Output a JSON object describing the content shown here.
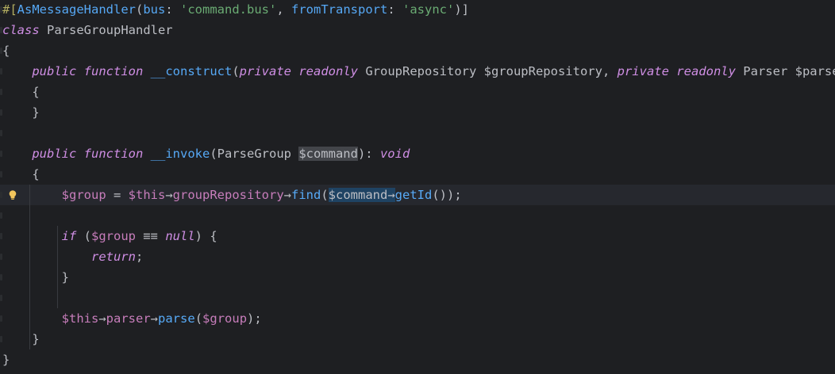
{
  "editor": {
    "language": "PHP",
    "background": "#1e1f22",
    "lines": [
      {
        "tokens": [
          {
            "t": "#[",
            "c": "t-attr"
          },
          {
            "t": "AsMessageHandler",
            "c": "t-fn"
          },
          {
            "t": "(",
            "c": "t-pl"
          },
          {
            "t": "bus",
            "c": "t-fn"
          },
          {
            "t": ": ",
            "c": "t-pl"
          },
          {
            "t": "'command.bus'",
            "c": "t-str"
          },
          {
            "t": ", ",
            "c": "t-pl"
          },
          {
            "t": "fromTransport",
            "c": "t-fn"
          },
          {
            "t": ": ",
            "c": "t-pl"
          },
          {
            "t": "'async'",
            "c": "t-str"
          },
          {
            "t": ")]",
            "c": "t-pl"
          }
        ]
      },
      {
        "tokens": [
          {
            "t": "class",
            "c": "t-kw"
          },
          {
            "t": " ParseGroupHandler",
            "c": "t-pl"
          }
        ]
      },
      {
        "tokens": [
          {
            "t": "{",
            "c": "t-pl"
          }
        ]
      },
      {
        "indent": "    ",
        "tokens": [
          {
            "t": "public",
            "c": "t-kw"
          },
          {
            "t": " ",
            "c": "t-pl"
          },
          {
            "t": "function",
            "c": "t-kw"
          },
          {
            "t": " ",
            "c": "t-pl"
          },
          {
            "t": "__construct",
            "c": "t-fn"
          },
          {
            "t": "(",
            "c": "t-pl"
          },
          {
            "t": "private",
            "c": "t-kw"
          },
          {
            "t": " ",
            "c": "t-pl"
          },
          {
            "t": "readonly",
            "c": "t-kw"
          },
          {
            "t": " GroupRepository $groupRepository, ",
            "c": "t-pl"
          },
          {
            "t": "private",
            "c": "t-kw"
          },
          {
            "t": " ",
            "c": "t-pl"
          },
          {
            "t": "readonly",
            "c": "t-kw"
          },
          {
            "t": " Parser $parser)",
            "c": "t-pl"
          }
        ]
      },
      {
        "indent": "    ",
        "tokens": [
          {
            "t": "{",
            "c": "t-pl"
          }
        ]
      },
      {
        "indent": "    ",
        "tokens": [
          {
            "t": "}",
            "c": "t-pl"
          }
        ]
      },
      {
        "tokens": []
      },
      {
        "indent": "    ",
        "tokens": [
          {
            "t": "public",
            "c": "t-kw"
          },
          {
            "t": " ",
            "c": "t-pl"
          },
          {
            "t": "function",
            "c": "t-kw"
          },
          {
            "t": " ",
            "c": "t-pl"
          },
          {
            "t": "__invoke",
            "c": "t-fn"
          },
          {
            "t": "(ParseGroup ",
            "c": "t-pl"
          },
          {
            "t": "$command",
            "c": "t-pl hl-sel"
          },
          {
            "t": "): ",
            "c": "t-pl"
          },
          {
            "t": "void",
            "c": "t-kw"
          }
        ]
      },
      {
        "indent": "    ",
        "tokens": [
          {
            "t": "{",
            "c": "t-pl"
          }
        ]
      },
      {
        "indent": "        ",
        "current": true,
        "bulb": true,
        "tokens": [
          {
            "t": "$group",
            "c": "t-var"
          },
          {
            "t": " = ",
            "c": "t-pl"
          },
          {
            "t": "$this",
            "c": "t-var"
          },
          {
            "t": "→",
            "c": "t-pl"
          },
          {
            "t": "groupRepository",
            "c": "t-field"
          },
          {
            "t": "→",
            "c": "t-pl"
          },
          {
            "t": "find",
            "c": "t-meth"
          },
          {
            "t": "(",
            "c": "t-pl"
          },
          {
            "t": "$command",
            "c": "t-pl hl-ref"
          },
          {
            "t": "→",
            "c": "t-pl hl-ref"
          },
          {
            "t": "getId",
            "c": "t-meth"
          },
          {
            "t": "());",
            "c": "t-pl"
          }
        ]
      },
      {
        "tokens": []
      },
      {
        "indent": "        ",
        "tokens": [
          {
            "t": "if",
            "c": "t-kw"
          },
          {
            "t": " (",
            "c": "t-pl"
          },
          {
            "t": "$group",
            "c": "t-var"
          },
          {
            "t": " ≡≡ ",
            "c": "t-pl"
          },
          {
            "t": "null",
            "c": "t-kw"
          },
          {
            "t": ") {",
            "c": "t-pl"
          }
        ]
      },
      {
        "indent": "            ",
        "tokens": [
          {
            "t": "return",
            "c": "t-kw"
          },
          {
            "t": ";",
            "c": "t-pl"
          }
        ]
      },
      {
        "indent": "        ",
        "tokens": [
          {
            "t": "}",
            "c": "t-pl"
          }
        ]
      },
      {
        "tokens": []
      },
      {
        "indent": "        ",
        "tokens": [
          {
            "t": "$this",
            "c": "t-var"
          },
          {
            "t": "→",
            "c": "t-pl"
          },
          {
            "t": "parser",
            "c": "t-field"
          },
          {
            "t": "→",
            "c": "t-pl"
          },
          {
            "t": "parse",
            "c": "t-meth"
          },
          {
            "t": "(",
            "c": "t-pl"
          },
          {
            "t": "$group",
            "c": "t-var"
          },
          {
            "t": ");",
            "c": "t-pl"
          }
        ]
      },
      {
        "indent": "    ",
        "tokens": [
          {
            "t": "}",
            "c": "t-pl"
          }
        ]
      },
      {
        "tokens": [
          {
            "t": "}",
            "c": "t-pl"
          }
        ]
      }
    ]
  }
}
